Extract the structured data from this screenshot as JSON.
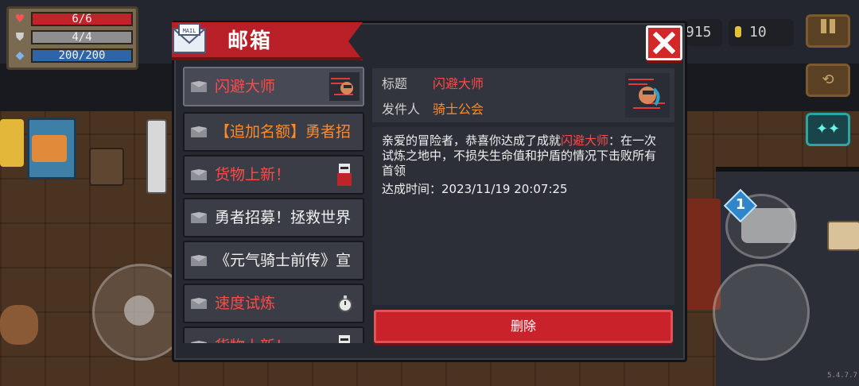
{
  "hud": {
    "hp": "6/6",
    "shield": "4/4",
    "mana": "200/200",
    "gems": "915",
    "coins": "10",
    "version": "5.4.7.7",
    "weapon_slot": "1"
  },
  "mailbox": {
    "title": "邮箱",
    "mail_icon_text": "MAIL",
    "items": [
      {
        "label": "闪避大师",
        "style": "red",
        "selected": true,
        "thumb": "dodge-master-thumbnail"
      },
      {
        "label": "【追加名额】勇者招",
        "style": "white-orange",
        "selected": false,
        "thumb": ""
      },
      {
        "label": "货物上新！",
        "style": "red",
        "selected": false,
        "thumb": "merchant-thumbnail"
      },
      {
        "label": "勇者招募！拯救世界",
        "style": "white",
        "selected": false,
        "thumb": ""
      },
      {
        "label": "《元气骑士前传》宣",
        "style": "white",
        "selected": false,
        "thumb": ""
      },
      {
        "label": "速度试炼",
        "style": "red",
        "selected": false,
        "thumb": "stopwatch-thumbnail"
      },
      {
        "label": "货物上新！",
        "style": "red",
        "selected": false,
        "thumb": "merchant-thumbnail"
      }
    ],
    "detail": {
      "title_label": "标题",
      "title_value": "闪避大师",
      "sender_label": "发件人",
      "sender_value": "骑士公会",
      "body_before": "亲爱的冒险者，恭喜你达成了成就",
      "body_highlight": "闪避大师",
      "body_after": "：在一次试炼之地中，不损失生命值和护盾的情况下击败所有首领",
      "time_text": "达成时间：2023/11/19 20:07:25"
    },
    "delete_label": "删除"
  },
  "colors": {
    "accent_red": "#d22828",
    "highlight_red": "#ff4a4a",
    "panel_dark": "#26282f"
  }
}
